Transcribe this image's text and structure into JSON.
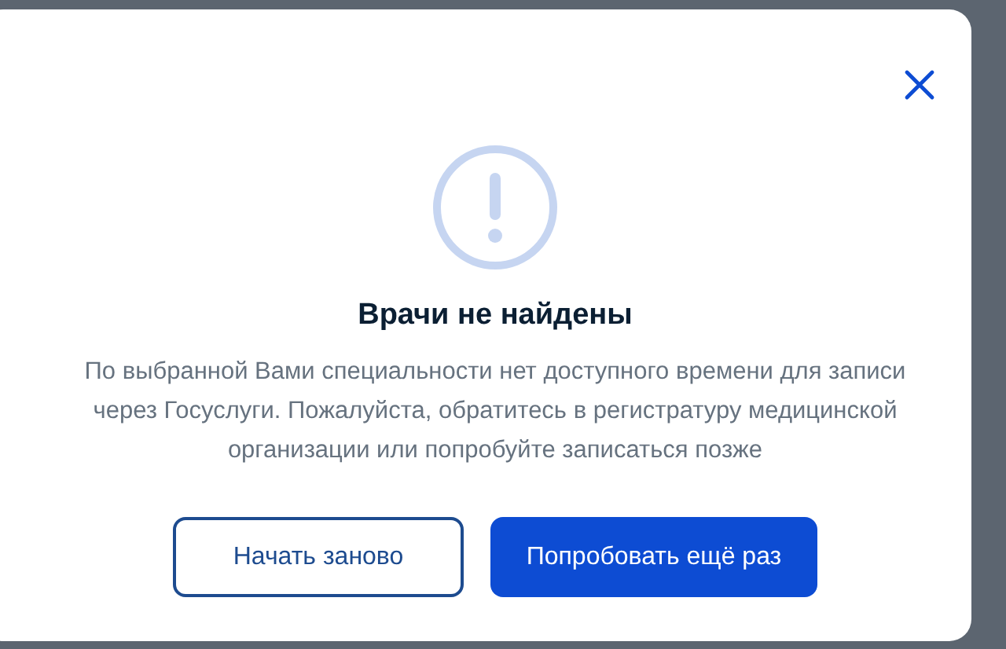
{
  "dialog": {
    "title": "Врачи не найдены",
    "message": "По выбранной Вами специальности нет доступного времени для записи через Госуслуги. Пожалуйста, обратитесь в регистратуру медицинской организации или попробуйте записаться позже",
    "buttons": [
      {
        "label": "Начать заново",
        "kind": "secondary"
      },
      {
        "label": "Попробовать ещё раз",
        "kind": "primary"
      }
    ]
  }
}
